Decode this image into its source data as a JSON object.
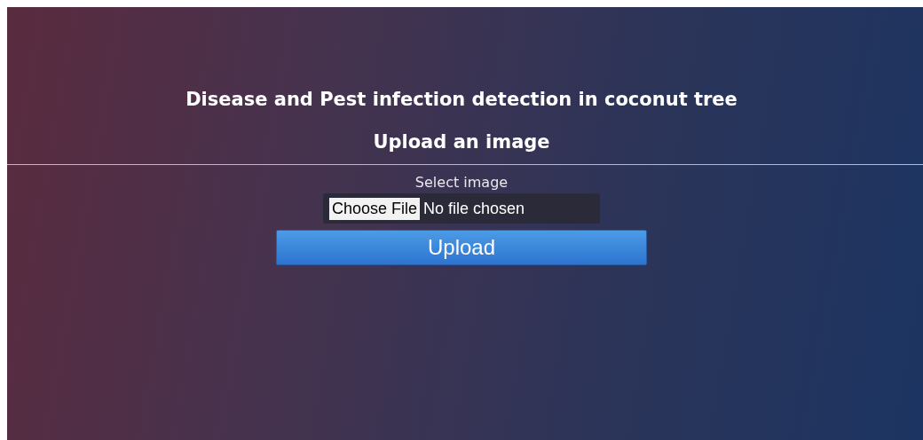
{
  "title": "Disease and Pest infection detection in coconut tree",
  "subtitle": "Upload an image",
  "form": {
    "label": "Select image",
    "file_button": "Choose File",
    "file_status": "No file chosen",
    "submit": "Upload"
  }
}
